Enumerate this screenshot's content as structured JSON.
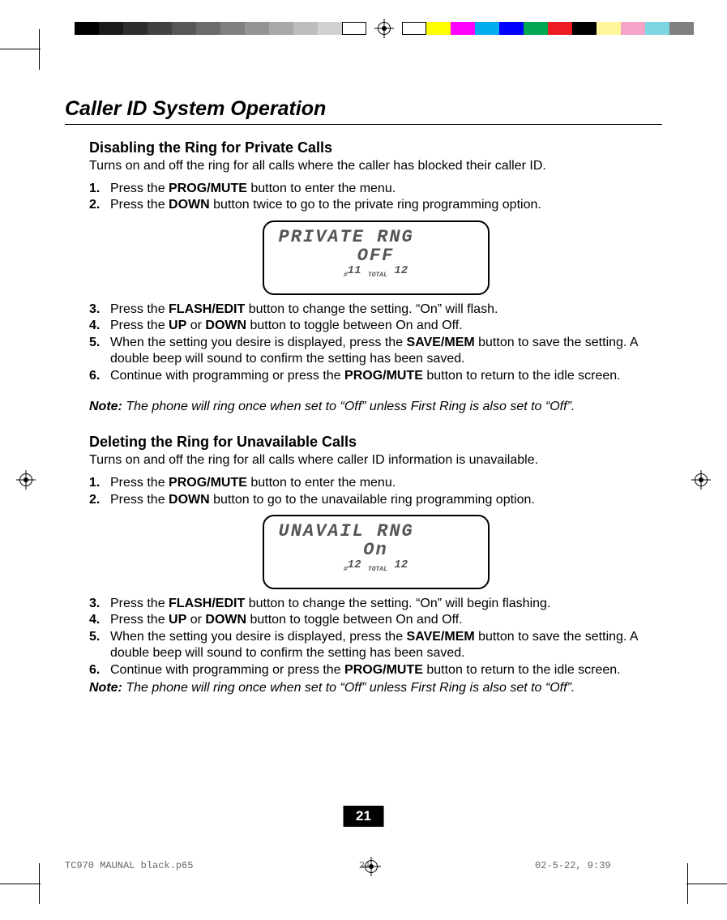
{
  "title": "Caller ID System Operation",
  "section1": {
    "heading": "Disabling the Ring for Private Calls",
    "lead": "Turns on and off the ring for all calls where the caller has blocked their caller ID.",
    "steps_a": [
      {
        "n": "1.",
        "pre": "Press the ",
        "bold": "PROG/MUTE",
        "post": " button to enter the menu."
      },
      {
        "n": "2.",
        "pre": "Press the ",
        "bold": "DOWN",
        "post": " button twice to go to the private ring programming option."
      }
    ],
    "lcd": {
      "title": "PRIVATE RNG",
      "value": "OFF",
      "idx": "11",
      "total_label": "TOTAL",
      "total": "12"
    },
    "steps_b": [
      {
        "n": "3.",
        "html": "Press the <span class=\"b\">FLASH/EDIT</span> button to change the setting. “On” will flash."
      },
      {
        "n": "4.",
        "html": "Press the  <span class=\"b\">UP</span>  or  <span class=\"b\">DOWN</span>  button to toggle between On and Off."
      },
      {
        "n": "5.",
        "html": "When the setting you desire is displayed, press the <span class=\"b\">SAVE/MEM</span> button to save the setting. A double beep will sound to confirm the setting has been saved."
      },
      {
        "n": "6.",
        "html": "Continue with programming or press the <span class=\"b\">PROG/MUTE</span> button to return to the idle screen."
      }
    ],
    "note_label": "Note:",
    "note": " The phone will ring once when set to “Off” unless First Ring is also set to “Off”."
  },
  "section2": {
    "heading": "Deleting the Ring for Unavailable Calls",
    "lead": "Turns on and off the ring for all calls where caller ID information is unavailable.",
    "steps_a": [
      {
        "n": "1.",
        "pre": "Press the ",
        "bold": "PROG/MUTE",
        "post": " button to enter the menu."
      },
      {
        "n": "2.",
        "pre": "Press the ",
        "bold": "DOWN",
        "post": " button to go to the unavailable ring programming option."
      }
    ],
    "lcd": {
      "title": "UNAVAIL RNG",
      "value": "On",
      "idx": "12",
      "total_label": "TOTAL",
      "total": "12"
    },
    "steps_b": [
      {
        "n": "3.",
        "html": "Press the <span class=\"b\">FLASH/EDIT</span> button to change the setting. “On” will begin flashing."
      },
      {
        "n": "4.",
        "html": "Press the <span class=\"b\">UP</span> or <span class=\"b\">DOWN</span> button to toggle between On and Off."
      },
      {
        "n": "5.",
        "html": "When the setting you desire is displayed, press the <span class=\"b\">SAVE/MEM</span> button to save the setting. A double beep will sound to confirm the setting has been saved."
      },
      {
        "n": "6.",
        "html": "Continue with programming or press the <span class=\"b\">PROG/MUTE</span> button to return to the idle screen."
      }
    ],
    "note_label": "Note:",
    "note": " The phone will ring once when set to “Off” unless First Ring is also set to “Off”."
  },
  "page_number": "21",
  "footer": {
    "file": "TC970 MAUNAL black.p65",
    "page": "21",
    "date": "02-5-22, 9:39"
  },
  "graysteps": [
    "#000000",
    "#1a1a1a",
    "#2e2e2e",
    "#424242",
    "#575757",
    "#6b6b6b",
    "#808080",
    "#949494",
    "#a8a8a8",
    "#bdbdbd",
    "#d1d1d1",
    "#ffffff"
  ],
  "colorsteps": [
    "#ffffff",
    "#ffff00",
    "#ff00ff",
    "#00aeef",
    "#0000ff",
    "#00a651",
    "#ed1c24",
    "#000000",
    "#fff799",
    "#f5a3c7",
    "#7fd4e3",
    "#808080"
  ]
}
